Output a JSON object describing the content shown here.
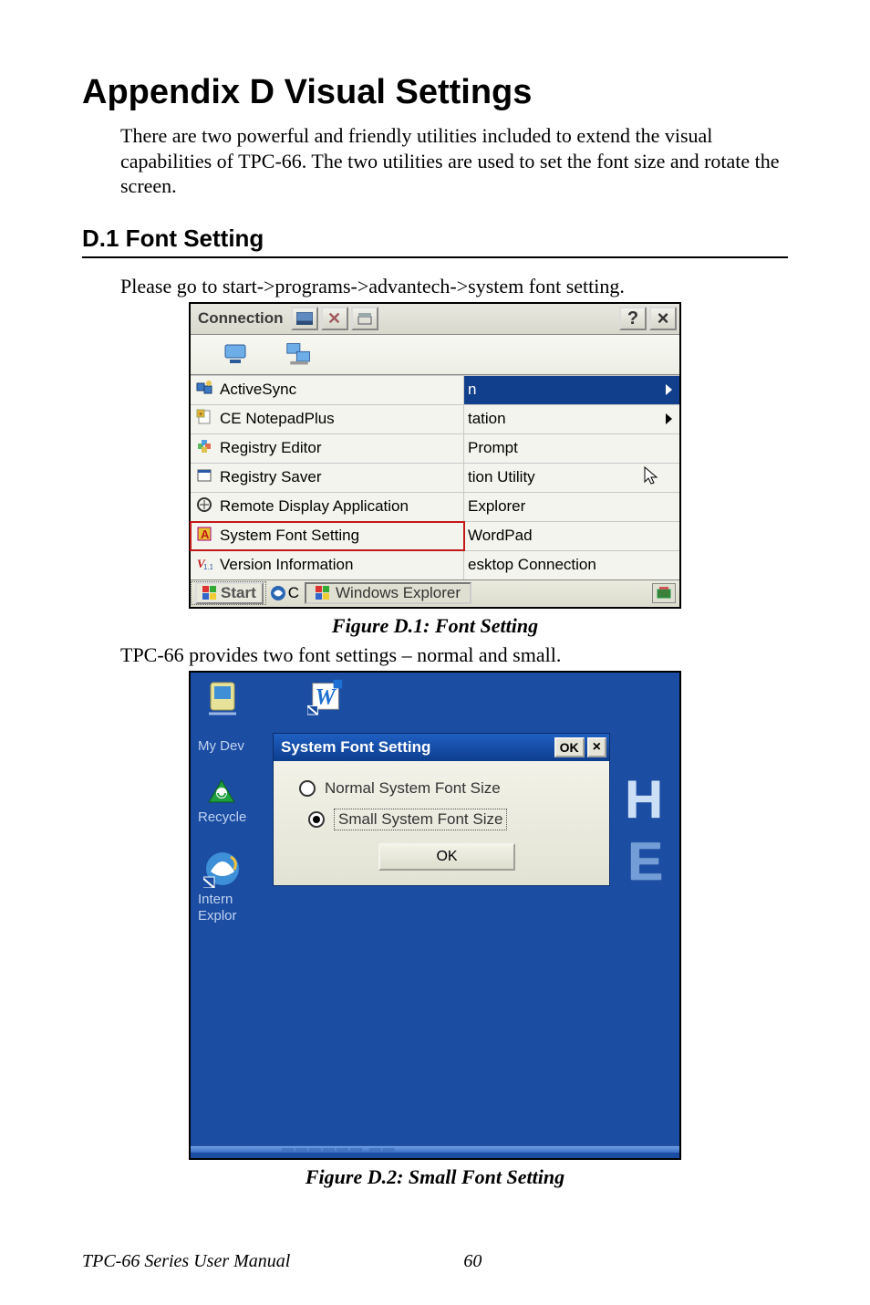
{
  "title": "Appendix D  Visual Settings",
  "intro": "There are two powerful and friendly utilities included to extend the visual capabilities of TPC-66. The two utilities are used to set the font size and rotate the screen.",
  "section": "D.1  Font Setting",
  "path_text": "Please go to start->programs->advantech->system font setting.",
  "fig1_caption": "Figure D.1: Font Setting",
  "after_caption": "TPC-66 provides two font settings – normal and small.",
  "fig2_caption": "Figure D.2: Small Font Setting",
  "footer_manual": "TPC-66 Series User Manual",
  "footer_page": "60",
  "win1": {
    "titlebar": "Connection",
    "help": "?",
    "close": "×",
    "rows": [
      {
        "left": "ActiveSync",
        "right": "n",
        "arrow": true,
        "bluecell": true
      },
      {
        "left": "CE NotepadPlus",
        "right": "tation",
        "arrow": true
      },
      {
        "left": "Registry Editor",
        "right": " Prompt"
      },
      {
        "left": "Registry Saver",
        "right": "tion Utility",
        "cursor": true
      },
      {
        "left": "Remote Display Application",
        "right": "Explorer"
      },
      {
        "left": "System Font Setting",
        "right": "WordPad",
        "highlight": true
      },
      {
        "left": "Version Information",
        "right": "esktop Connection"
      }
    ],
    "start": "Start",
    "cc_label": "C",
    "task_btn": "Windows Explorer"
  },
  "win2": {
    "mydev_label": "My Dev",
    "recycle_label": "Recycle",
    "intern_label": "Intern",
    "explor_label": "Explor",
    "dialog_title": "System Font Setting",
    "ok_small": "OK",
    "close": "×",
    "radio_normal": "Normal System Font Size",
    "radio_small": "Small System Font Size",
    "ok_btn": "OK",
    "big_H": "H",
    "big_E": "E"
  }
}
